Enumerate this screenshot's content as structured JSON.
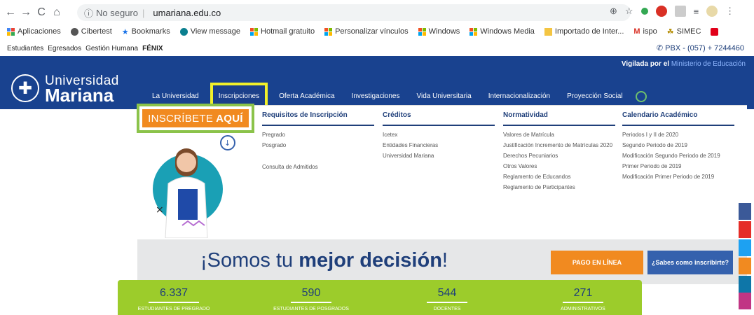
{
  "browser": {
    "security_label": "No seguro",
    "url": "umariana.edu.co",
    "bookmarks": [
      {
        "label": "Aplicaciones"
      },
      {
        "label": "Cibertest"
      },
      {
        "label": "Bookmarks"
      },
      {
        "label": "View message"
      },
      {
        "label": "Hotmail gratuito"
      },
      {
        "label": "Personalizar vínculos"
      },
      {
        "label": "Windows"
      },
      {
        "label": "Windows Media"
      },
      {
        "label": "Importado de Inter..."
      },
      {
        "label": "ispo"
      },
      {
        "label": "SIMEC"
      }
    ]
  },
  "topbar": {
    "links": [
      "Estudiantes",
      "Egresados",
      "Gestión Humana"
    ],
    "fenix": "FÉNIX",
    "phone": "PBX - (057) + 7244460"
  },
  "header": {
    "logo_line1": "Universidad",
    "logo_line2": "Mariana",
    "vigilada": "Vigilada por el",
    "ministerio": "Ministerio de Educación",
    "menu": [
      "La Universidad",
      "Inscripciones",
      "Oferta Académica",
      "Investigaciones",
      "Vida Universitaria",
      "Internacionalización",
      "Proyección Social"
    ]
  },
  "dropdown": {
    "inscribete": "INSCRÍBETE",
    "inscribete_bold": "AQUÍ",
    "columns": [
      {
        "title": "Requisitos de Inscripción",
        "links": [
          "Pregrado",
          "Posgrado",
          "",
          "Consulta de Admitidos"
        ]
      },
      {
        "title": "Créditos",
        "links": [
          "Icetex",
          "Entidades Financieras",
          "Universidad Mariana"
        ]
      },
      {
        "title": "Normatividad",
        "links": [
          "Valores de Matrícula",
          "Justificación Incremento de Matrículas 2020",
          "Derechos Pecuniarios",
          "Otros Valores",
          "Reglamento de Educandos",
          "Reglamento de Participantes"
        ]
      },
      {
        "title": "Calendario Académico",
        "links": [
          "Periodos I y II de 2020",
          "Segundo Periodo de 2019",
          "Modificación Segundo Periodo de 2019",
          "Primer Periodo de 2019",
          "Modificación Primer Periodo de 2019"
        ]
      }
    ]
  },
  "banner": {
    "text_pre": "¡Somos tu",
    "text_bold": "mejor decisión",
    "text_post": "!",
    "pago": "PAGO EN LÍNEA",
    "sabes": "¿Sabes como inscribirte?"
  },
  "stats": [
    {
      "value": "6.337",
      "label": "ESTUDIANTES DE PREGRADO"
    },
    {
      "value": "590",
      "label": "ESTUDIANTES DE POSGRADOS"
    },
    {
      "value": "544",
      "label": "DOCENTES"
    },
    {
      "value": "271",
      "label": "ADMINISTRATIVOS"
    }
  ],
  "colors": {
    "header_blue": "#19428f",
    "accent_orange": "#f18a20",
    "stats_green": "#9ccc2b",
    "highlight_yellow": "#f1f02a",
    "highlight_green": "#8bc34a"
  }
}
